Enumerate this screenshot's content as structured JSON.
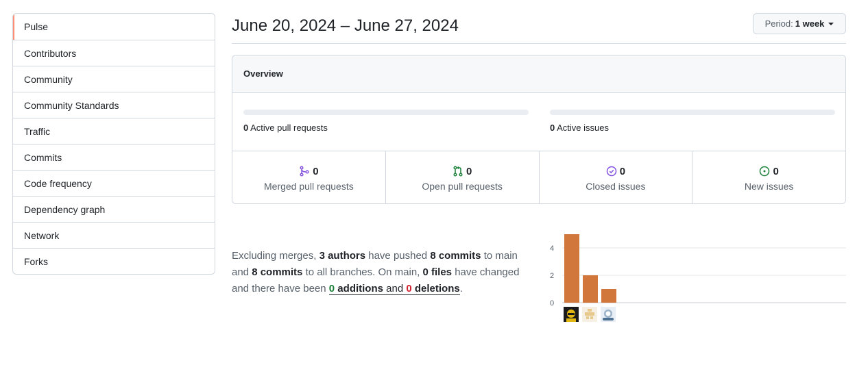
{
  "sidebar": {
    "items": [
      {
        "label": "Pulse",
        "selected": true
      },
      {
        "label": "Contributors"
      },
      {
        "label": "Community"
      },
      {
        "label": "Community Standards"
      },
      {
        "label": "Traffic"
      },
      {
        "label": "Commits"
      },
      {
        "label": "Code frequency"
      },
      {
        "label": "Dependency graph"
      },
      {
        "label": "Network"
      },
      {
        "label": "Forks"
      }
    ]
  },
  "header": {
    "date_range": "June 20, 2024 – June 27, 2024",
    "period_label": "Period:",
    "period_value": "1 week"
  },
  "overview": {
    "title": "Overview",
    "active_prs_count": "0",
    "active_prs_label": "Active pull requests",
    "active_issues_count": "0",
    "active_issues_label": "Active issues",
    "stats": [
      {
        "icon": "merged-pr-icon",
        "count": "0",
        "label": "Merged pull requests",
        "color": "#8250df"
      },
      {
        "icon": "open-pr-icon",
        "count": "0",
        "label": "Open pull requests",
        "color": "#1a7f37"
      },
      {
        "icon": "closed-issue-icon",
        "count": "0",
        "label": "Closed issues",
        "color": "#8250df"
      },
      {
        "icon": "new-issue-icon",
        "count": "0",
        "label": "New issues",
        "color": "#1a7f37"
      }
    ]
  },
  "summary": {
    "p1": "Excluding merges, ",
    "authors": "3 authors",
    "p2": " have pushed ",
    "commits_main": "8 commits",
    "p3": " to main and ",
    "commits_all": "8 commits",
    "p4": " to all branches. On main, ",
    "files": "0 files",
    "p5": " have changed and there have been ",
    "additions_count": "0",
    "additions_word": " additions",
    "and_word": " and ",
    "deletions_count": "0",
    "deletions_word": " deletions",
    "p6": "."
  },
  "chart_data": {
    "type": "bar",
    "categories": [
      "author-1",
      "author-2",
      "author-3"
    ],
    "values": [
      5,
      2,
      1
    ],
    "y_ticks": [
      "0",
      "2",
      "4"
    ],
    "ylim": [
      0,
      5
    ],
    "bar_color": "#d1773b",
    "grid": true
  }
}
